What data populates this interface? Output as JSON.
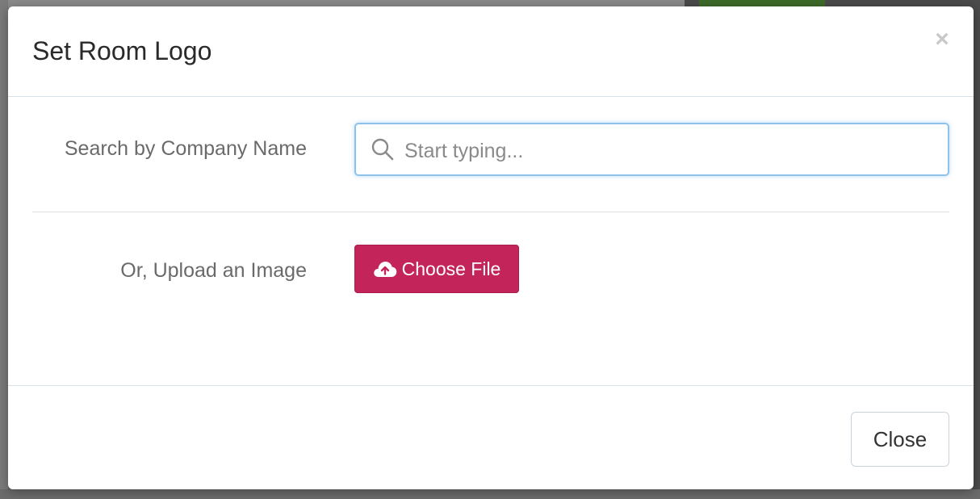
{
  "modal": {
    "title": "Set Room Logo",
    "close_glyph": "×",
    "search": {
      "label": "Search by Company Name",
      "placeholder": "Start typing...",
      "value": "",
      "icon": "search-icon"
    },
    "upload": {
      "label": "Or, Upload an Image",
      "button_label": "Choose File",
      "icon": "cloud-upload-icon"
    },
    "footer": {
      "close_label": "Close"
    }
  },
  "colors": {
    "primary_button": "#c3245a",
    "focus_border": "#8ec2ea",
    "label_text": "#6a6a6a"
  }
}
